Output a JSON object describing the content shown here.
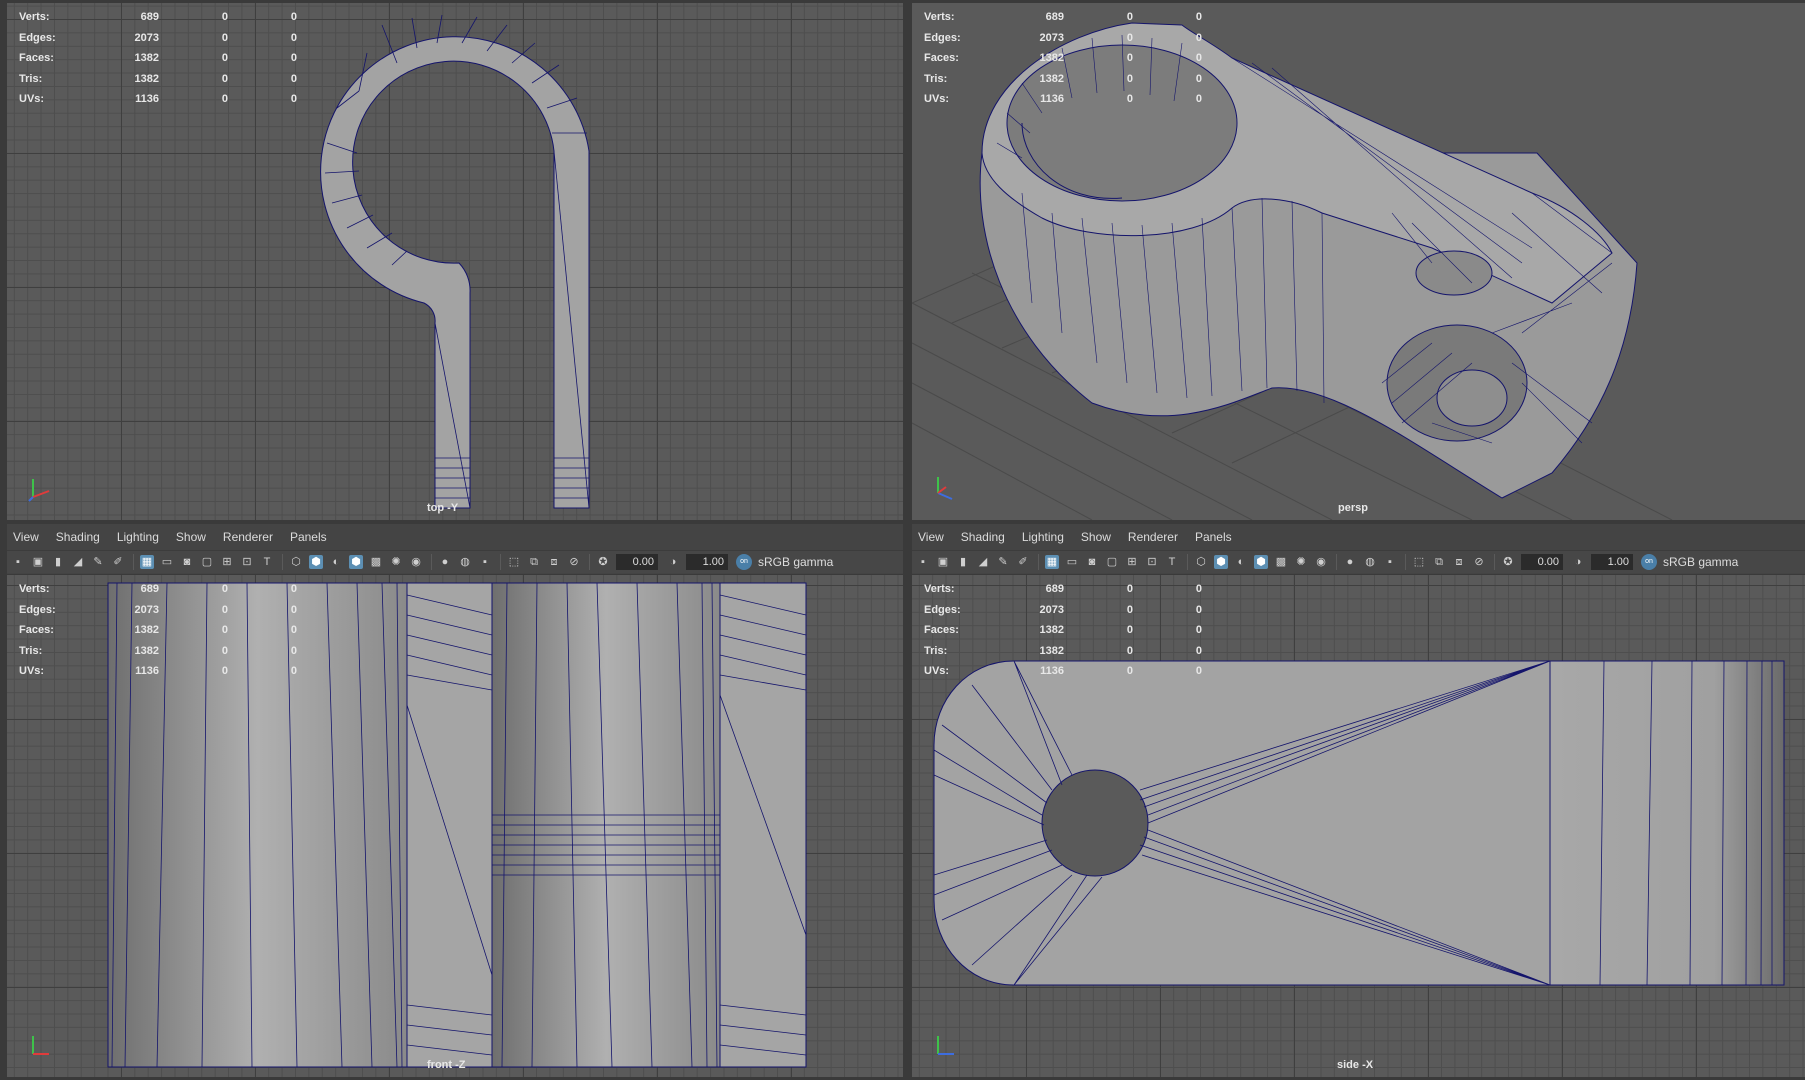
{
  "hud": {
    "rows": [
      {
        "label": "Verts:",
        "value": "689",
        "a": "0",
        "b": "0"
      },
      {
        "label": "Edges:",
        "value": "2073",
        "a": "0",
        "b": "0"
      },
      {
        "label": "Faces:",
        "value": "1382",
        "a": "0",
        "b": "0"
      },
      {
        "label": "Tris:",
        "value": "1382",
        "a": "0",
        "b": "0"
      },
      {
        "label": "UVs:",
        "value": "1136",
        "a": "0",
        "b": "0"
      }
    ]
  },
  "viewports": {
    "top": {
      "camera": "top -Y"
    },
    "persp": {
      "camera": "persp"
    },
    "front": {
      "camera": "front -Z"
    },
    "side": {
      "camera": "side -X"
    }
  },
  "menu": {
    "view": "View",
    "shading": "Shading",
    "lighting": "Lighting",
    "show": "Show",
    "renderer": "Renderer",
    "panels": "Panels"
  },
  "toolbar": {
    "exposure": "0.00",
    "gamma": "1.00",
    "color_space": "sRGB gamma",
    "color_space_icon": "on"
  },
  "colors": {
    "mesh_fill": "#a3a3a3",
    "wire": "#14146b",
    "viewport_bg": "#5a5a5a",
    "active_icon": "#5c8fb3"
  }
}
